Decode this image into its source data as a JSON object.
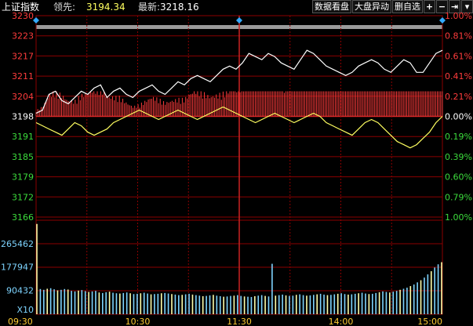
{
  "header": {
    "index_name": "上证指数",
    "lead_label": "领先:",
    "lead_value": "3194.34",
    "latest_label": "最新:",
    "latest_value": "3218.16"
  },
  "toolbar": {
    "data_view": "数据看盘",
    "market_change": "大盘异动",
    "delete_self": "删自选"
  },
  "icons": {
    "add": "+",
    "remove": "−",
    "next": "⇥",
    "dropdown": "▾"
  },
  "colors": {
    "up": "#ff3c3c",
    "down": "#3cdc3c",
    "flat": "#ffffff",
    "grid": "#8b0000",
    "volume": "#7ed4ff",
    "price_line": "#ffffff",
    "lead_line": "#ffff60"
  },
  "chart_data": [
    {
      "type": "line",
      "y_price_labels": [
        "3230",
        "3223",
        "3217",
        "3211",
        "3204",
        "3198",
        "3191",
        "3185",
        "3179",
        "3172",
        "3166"
      ],
      "y_pct_labels": [
        "1.00%",
        "0.81%",
        "0.61%",
        "0.41%",
        "0.21%",
        "0.00%",
        "0.19%",
        "0.39%",
        "0.60%",
        "0.79%",
        "1.00%"
      ],
      "ylim": [
        3166,
        3230
      ],
      "prev_close": 3198,
      "x_labels": [
        "09:30",
        "10:30",
        "11:30",
        "14:00",
        "15:00"
      ],
      "series": [
        {
          "name": "最新",
          "values": [
            3199,
            3200,
            3205,
            3206,
            3203,
            3202,
            3204,
            3206,
            3205,
            3207,
            3208,
            3204,
            3206,
            3207,
            3205,
            3204,
            3206,
            3207,
            3208,
            3206,
            3205,
            3207,
            3209,
            3208,
            3210,
            3211,
            3210,
            3209,
            3211,
            3213,
            3214,
            3213,
            3215,
            3218,
            3217,
            3216,
            3218,
            3217,
            3215,
            3214,
            3213,
            3216,
            3219,
            3218,
            3216,
            3214,
            3213,
            3212,
            3211,
            3212,
            3214,
            3215,
            3216,
            3215,
            3213,
            3212,
            3214,
            3216,
            3215,
            3212,
            3212,
            3215,
            3218,
            3219
          ],
          "x_start": "09:30",
          "x_end": "15:00"
        },
        {
          "name": "领先",
          "values": [
            3196,
            3195,
            3194,
            3193,
            3192,
            3194,
            3196,
            3195,
            3193,
            3192,
            3193,
            3194,
            3196,
            3197,
            3198,
            3199,
            3200,
            3199,
            3198,
            3197,
            3198,
            3199,
            3200,
            3199,
            3198,
            3197,
            3198,
            3199,
            3200,
            3201,
            3200,
            3199,
            3198,
            3197,
            3196,
            3197,
            3198,
            3199,
            3198,
            3197,
            3196,
            3197,
            3198,
            3199,
            3198,
            3196,
            3195,
            3194,
            3193,
            3192,
            3194,
            3196,
            3197,
            3196,
            3194,
            3192,
            3190,
            3189,
            3188,
            3189,
            3191,
            3193,
            3196,
            3198
          ],
          "x_start": "09:30",
          "x_end": "15:00"
        }
      ]
    },
    {
      "type": "bar",
      "name": "volume",
      "y_labels": [
        "265462",
        "177947",
        "90432"
      ],
      "unit_label": "X10",
      "ylim": [
        0,
        354000
      ],
      "values": [
        340000,
        95000,
        92000,
        96000,
        98000,
        94000,
        90000,
        92000,
        95000,
        93000,
        88000,
        86000,
        89000,
        91000,
        87000,
        84000,
        86000,
        88000,
        82000,
        80000,
        83000,
        85000,
        81000,
        79000,
        78000,
        80000,
        82000,
        79000,
        76000,
        77000,
        79000,
        81000,
        78000,
        75000,
        76000,
        77000,
        79000,
        80000,
        78000,
        76000,
        74000,
        72000,
        73000,
        75000,
        77000,
        74000,
        72000,
        70000,
        68000,
        69000,
        71000,
        73000,
        70000,
        68000,
        66000,
        67000,
        69000,
        70000,
        72000,
        69000,
        67000,
        66000,
        65000,
        68000,
        70000,
        72000,
        69000,
        67000,
        190000,
        70000,
        72000,
        74000,
        71000,
        69000,
        70000,
        73000,
        75000,
        72000,
        70000,
        71000,
        73000,
        75000,
        77000,
        74000,
        72000,
        73000,
        75000,
        77000,
        79000,
        76000,
        74000,
        75000,
        77000,
        79000,
        81000,
        78000,
        76000,
        77000,
        80000,
        83000,
        86000,
        84000,
        82000,
        85000,
        88000,
        92000,
        96000,
        100000,
        106000,
        112000,
        120000,
        128000,
        138000,
        150000,
        162000,
        176000,
        188000,
        196000
      ]
    }
  ]
}
